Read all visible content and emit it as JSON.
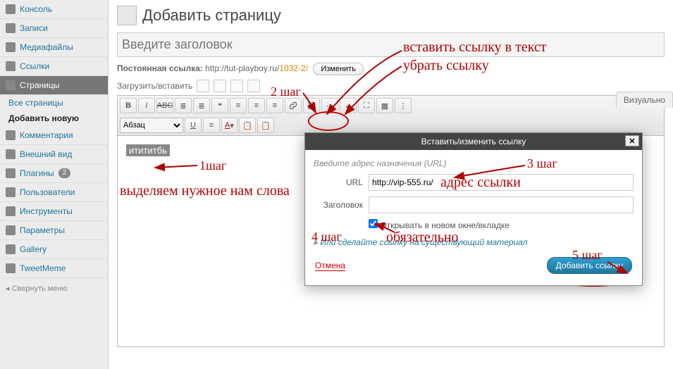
{
  "sidebar": {
    "items": [
      {
        "label": "Консоль",
        "icon": "dash"
      },
      {
        "label": "Записи",
        "icon": "pin"
      },
      {
        "label": "Медиафайлы",
        "icon": "media"
      },
      {
        "label": "Ссылки",
        "icon": "link"
      },
      {
        "label": "Страницы",
        "icon": "page",
        "active": true
      },
      {
        "label": "Комментарии",
        "icon": "comment"
      },
      {
        "label": "Внешний вид",
        "icon": "appearance"
      },
      {
        "label": "Плагины",
        "icon": "plugin",
        "badge": "2"
      },
      {
        "label": "Пользователи",
        "icon": "users"
      },
      {
        "label": "Инструменты",
        "icon": "tools"
      },
      {
        "label": "Параметры",
        "icon": "settings"
      },
      {
        "label": "Gallery",
        "icon": "gallery"
      },
      {
        "label": "TweetMeme",
        "icon": "tweet"
      }
    ],
    "sub_all": "Все страницы",
    "sub_add": "Добавить новую",
    "collapse": "Свернуть меню"
  },
  "header": {
    "title": "Добавить страницу"
  },
  "title_placeholder": "Введите заголовок",
  "permalink": {
    "label": "Постоянная ссылка:",
    "base": "http://tut-playboy.ru/",
    "slug": "1032-2/",
    "edit": "Изменить"
  },
  "upload": {
    "label": "Загрузить/вставить"
  },
  "tabs": {
    "visual": "Визуально"
  },
  "format_select": "Абзац",
  "selected_text": "итититбь",
  "modal": {
    "title": "Вставить/изменить ссылку",
    "hint": "Введите адрес назначения (URL)",
    "url_label": "URL",
    "url_value": "http://vip-555.ru/",
    "title_label": "Заголовок",
    "title_value": "",
    "newtab": "Открывать в новом окне/вкладке",
    "newtab_checked": true,
    "existing": "Или сделайте ссылку на существующий материал",
    "cancel": "Отмена",
    "submit": "Добавить ссылку"
  },
  "annotations": {
    "a1": "1шаг",
    "a2": "2 шаг",
    "a3": "3 шаг",
    "a4": "4 шаг",
    "a5": "5 шаг",
    "sel": "выделяем нужное нам слова",
    "insert": "вставить ссылку в текст",
    "remove": "убрать ссылку",
    "addr": "адрес ссылки",
    "must": "обязательно"
  }
}
